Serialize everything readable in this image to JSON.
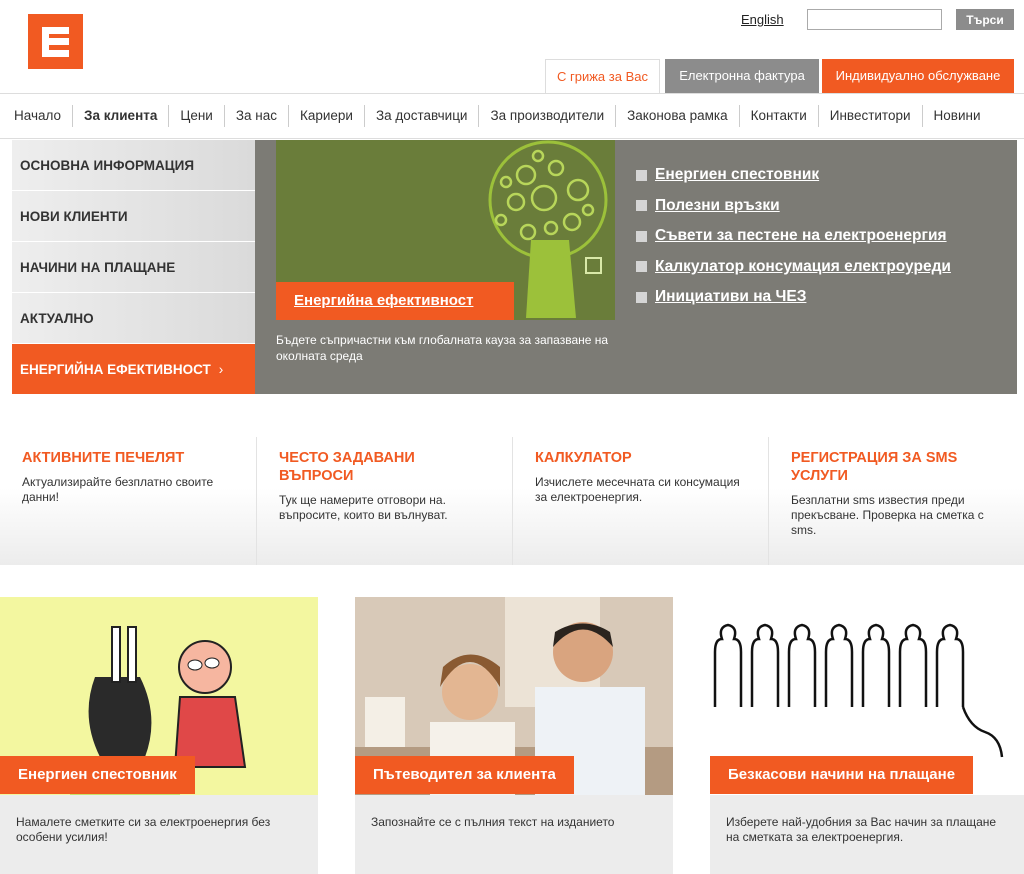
{
  "header": {
    "logo_alt": "ЧЕЗ",
    "lang_link": "English",
    "search": {
      "value": "",
      "placeholder": "",
      "button": "Търси"
    },
    "tabs": [
      {
        "label": "С грижа за Вас"
      },
      {
        "label": "Електронна фактура"
      },
      {
        "label": "Индивидуално обслужване"
      }
    ]
  },
  "nav": {
    "items": [
      {
        "label": "Начало"
      },
      {
        "label": "За клиента"
      },
      {
        "label": "Цени"
      },
      {
        "label": "За нас"
      },
      {
        "label": "Кариери"
      },
      {
        "label": "За доставчици"
      },
      {
        "label": "За производители"
      },
      {
        "label": "Законова рамка"
      },
      {
        "label": "Контакти"
      },
      {
        "label": "Инвеститори"
      },
      {
        "label": "Новини"
      }
    ]
  },
  "sidebar": {
    "items": [
      {
        "label": "Основна информация"
      },
      {
        "label": "Нови клиенти"
      },
      {
        "label": "Начини на плащане"
      },
      {
        "label": "Актуално"
      },
      {
        "label": "Енергийна ефективност",
        "chev": "›"
      }
    ]
  },
  "hero": {
    "title": "Енергийна ефективност",
    "description": "Бъдете съпричастни към глобалната кауза за запазване на околната среда",
    "links": [
      {
        "label": "Енергиен спестовник"
      },
      {
        "label": "Полезни връзки"
      },
      {
        "label": "Съвети за пестене на електроенергия"
      },
      {
        "label": "Калкулатор консумация електроуреди"
      },
      {
        "label": "Инициативи на ЧЕЗ"
      }
    ]
  },
  "promos": [
    {
      "title": "Активните печелят",
      "text": "Актуализирайте безплатно своите данни!"
    },
    {
      "title": "Често задавани въпроси",
      "text": "Тук ще намерите отговори на. въпросите, които ви вълнуват."
    },
    {
      "title": "Калкулатор",
      "text": "Изчислете месечната си консумация за електроенергия."
    },
    {
      "title": "Регистрация за SMS услуги",
      "text": "Безплатни sms известия преди прекъсване. Проверка на сметка с sms."
    }
  ],
  "cards": [
    {
      "title": "Енергиен спестовник",
      "text": "Намалете сметките си за електроенергия без особени усилия!"
    },
    {
      "title": "Пътеводител за клиента",
      "text": "Запознайте се с пълния текст на изданието"
    },
    {
      "title": "Безкасови начини на плащане",
      "text": "Изберете най-удобния за Вас начин за плащане на сметката за електроенергия."
    }
  ],
  "colors": {
    "brand": "#f15a22",
    "gray": "#8c8c8c",
    "hero_bg": "#7c7b75"
  }
}
